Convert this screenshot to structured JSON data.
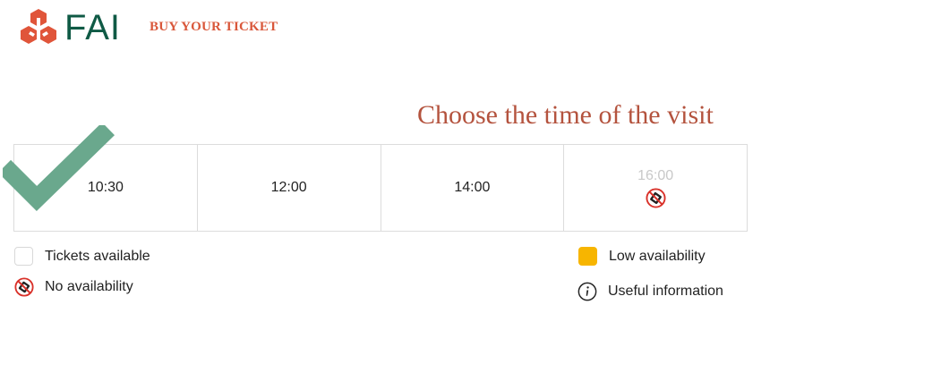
{
  "header": {
    "logo_text": "FAI",
    "nav_link": "BUY YOUR TICKET"
  },
  "title": "Choose the time of the visit",
  "slots": [
    {
      "time": "10:30",
      "available": true,
      "selected": true
    },
    {
      "time": "12:00",
      "available": true,
      "selected": false
    },
    {
      "time": "14:00",
      "available": true,
      "selected": false
    },
    {
      "time": "16:00",
      "available": false,
      "selected": false
    }
  ],
  "legend": {
    "tickets_available": "Tickets available",
    "no_availability": "No availability",
    "low_availability": "Low availability",
    "useful_information": "Useful information"
  },
  "colors": {
    "brand_red": "#e0553a",
    "brand_green": "#0f5a45",
    "title": "#b4533e",
    "check": "#6aa88d",
    "low": "#f7b500"
  },
  "icons": {
    "logo": "fai-logo-icon",
    "selected": "checkmark-icon",
    "no_availability": "no-ticket-icon",
    "info": "info-icon"
  }
}
